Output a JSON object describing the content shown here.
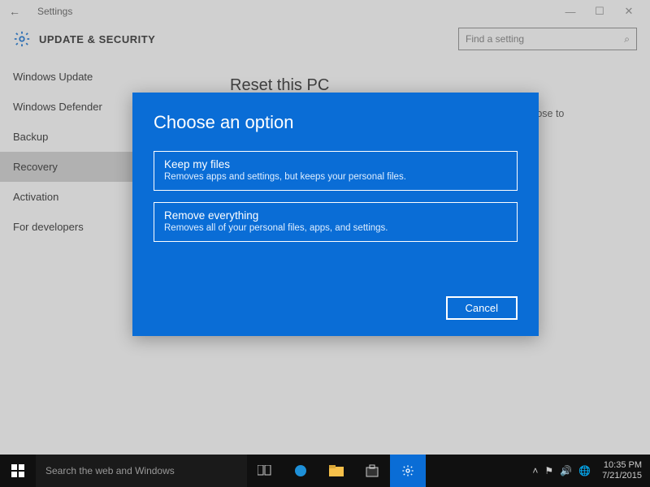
{
  "window": {
    "title": "Settings",
    "minimize": "—",
    "maximize": "☐",
    "close": "✕"
  },
  "header": {
    "title": "UPDATE & SECURITY",
    "search_placeholder": "Find a setting"
  },
  "sidebar": {
    "items": [
      {
        "label": "Windows Update"
      },
      {
        "label": "Windows Defender"
      },
      {
        "label": "Backup"
      },
      {
        "label": "Recovery"
      },
      {
        "label": "Activation"
      },
      {
        "label": "For developers"
      }
    ],
    "selected_index": 3
  },
  "content": {
    "heading": "Reset this PC",
    "paragraph": "If your PC isn't running well, resetting it might help. This lets you choose to keep your files or remove them, and then reinstalls"
  },
  "dialog": {
    "title": "Choose an option",
    "options": [
      {
        "title": "Keep my files",
        "desc": "Removes apps and settings, but keeps your personal files."
      },
      {
        "title": "Remove everything",
        "desc": "Removes all of your personal files, apps, and settings."
      }
    ],
    "cancel": "Cancel"
  },
  "taskbar": {
    "search_placeholder": "Search the web and Windows",
    "clock_time": "10:35 PM",
    "clock_date": "7/21/2015"
  },
  "colors": {
    "accent": "#0a6dd6"
  }
}
